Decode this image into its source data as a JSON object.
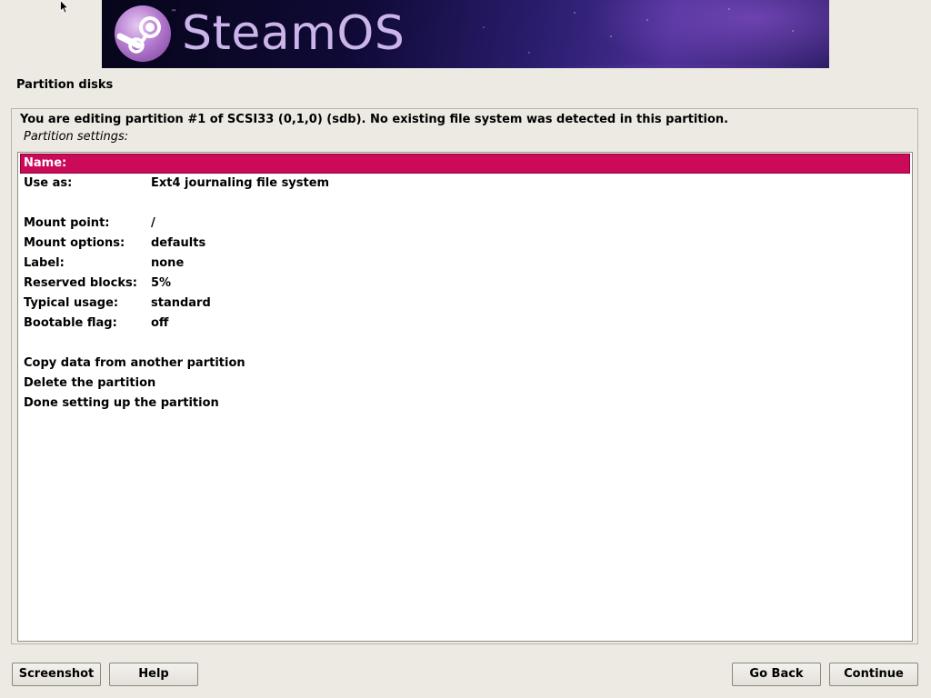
{
  "banner": {
    "brand": "SteamOS",
    "trademark": "™",
    "logo_icon": "steam-logo-icon"
  },
  "section_title": "Partition disks",
  "description": "You are editing partition #1 of SCSI33 (0,1,0) (sdb). No existing file system was detected in this partition.",
  "subdescription": "Partition settings:",
  "settings": {
    "name": {
      "label": "Name:",
      "value": ""
    },
    "use_as": {
      "label": "Use as:",
      "value": "Ext4 journaling file system"
    },
    "mount_point": {
      "label": "Mount point:",
      "value": "/"
    },
    "mount_options": {
      "label": "Mount options:",
      "value": "defaults"
    },
    "label": {
      "label": "Label:",
      "value": "none"
    },
    "reserved_blocks": {
      "label": "Reserved blocks:",
      "value": "5%"
    },
    "typical_usage": {
      "label": "Typical usage:",
      "value": "standard"
    },
    "bootable_flag": {
      "label": "Bootable flag:",
      "value": "off"
    }
  },
  "actions": {
    "copy": "Copy data from another partition",
    "delete": "Delete the partition",
    "done": "Done setting up the partition"
  },
  "buttons": {
    "screenshot": "Screenshot",
    "help": "Help",
    "go_back": "Go Back",
    "continue": "Continue"
  },
  "colors": {
    "selection": "#cc0a5a",
    "background": "#edeae3"
  }
}
